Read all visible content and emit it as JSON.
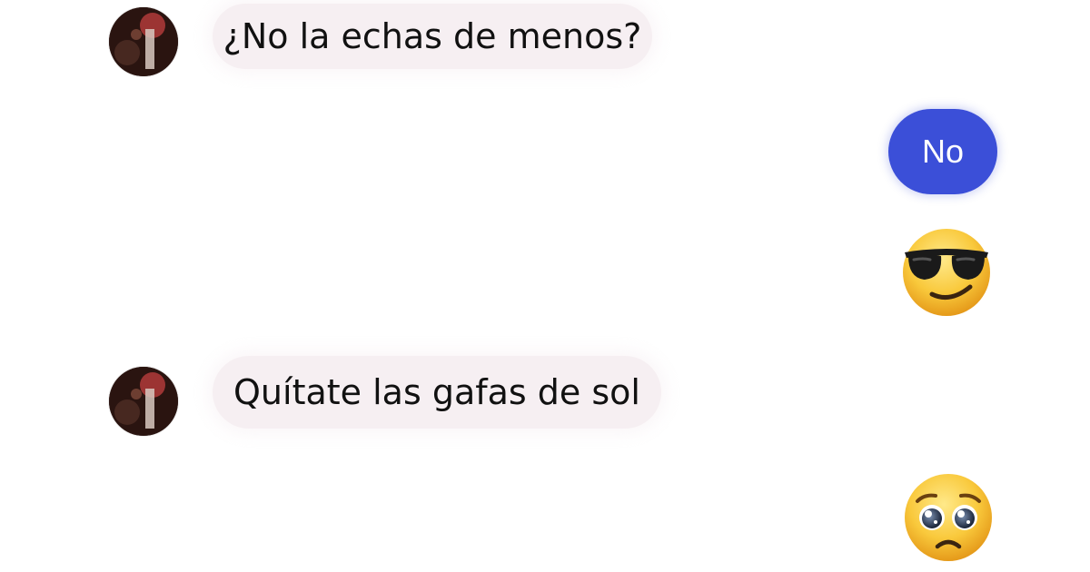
{
  "conversation": {
    "messages": [
      {
        "sender": "contact",
        "text": "¿No la echas de menos?"
      },
      {
        "sender": "me",
        "text": "No"
      },
      {
        "sender": "me",
        "emoji": "smiling-face-with-sunglasses"
      },
      {
        "sender": "contact",
        "text": "Quítate las gafas de sol"
      },
      {
        "sender": "me",
        "emoji": "pleading-face"
      }
    ]
  },
  "colors": {
    "incoming_bubble": "#f6eff2",
    "outgoing_bubble": "#3b4fd8",
    "emoji_yellow": "#f7c23a"
  }
}
